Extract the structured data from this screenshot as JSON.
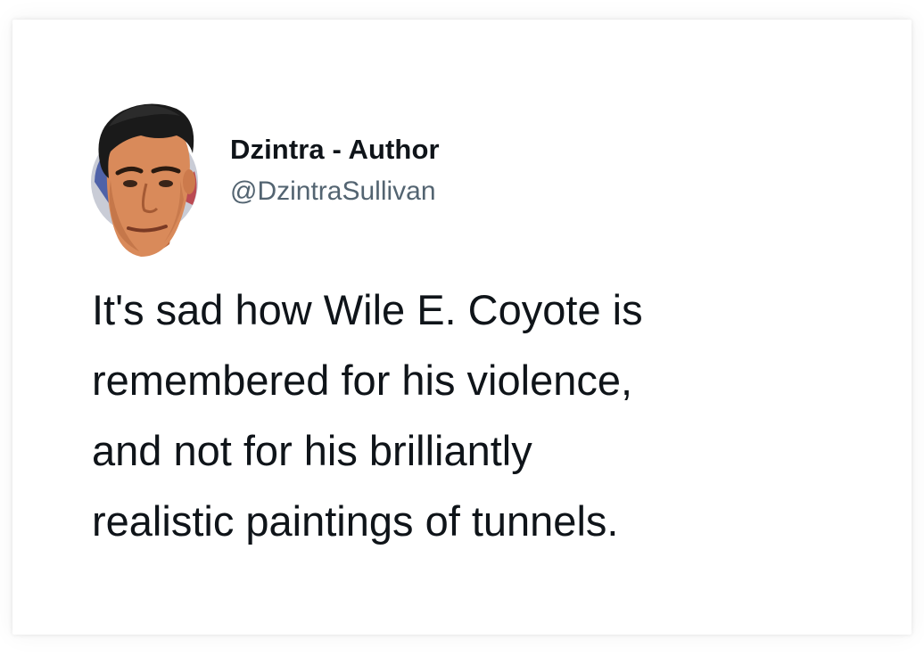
{
  "tweet": {
    "author": {
      "display_name": "Dzintra - Author",
      "handle": "@DzintraSullivan",
      "avatar_icon": "profile-photo"
    },
    "text_lines": [
      "It's sad how Wile E. Coyote is",
      "remembered for his violence,",
      "and not for his brilliantly",
      "realistic paintings of tunnels."
    ]
  },
  "colors": {
    "background": "#ffffff",
    "text_primary": "#0f1419",
    "text_secondary": "#536471"
  }
}
